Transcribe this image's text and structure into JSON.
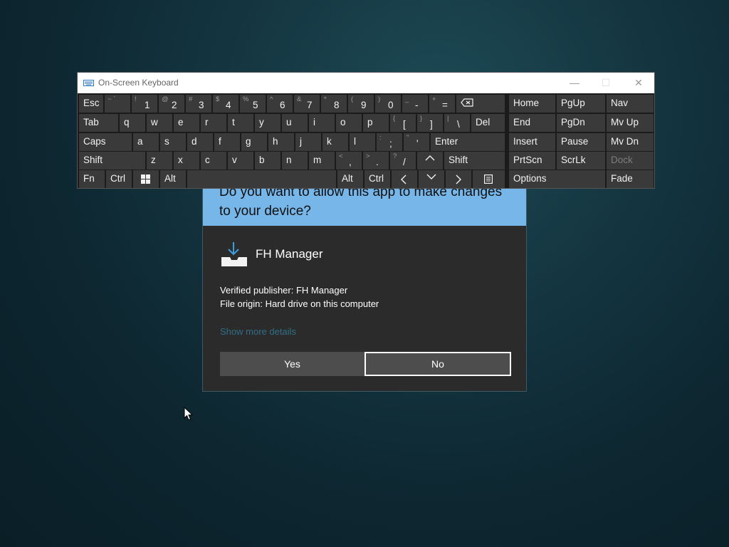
{
  "uac": {
    "question": "Do you want to allow this app to make changes to your device?",
    "app_name": "FH Manager",
    "publisher": "Verified publisher: FH Manager",
    "origin": "File origin: Hard drive on this computer",
    "more_details": "Show more details",
    "yes_label": "Yes",
    "no_label": "No"
  },
  "osk": {
    "title": "On-Screen Keyboard",
    "controls": {
      "minimize": "—",
      "maximize": "☐",
      "close": "✕"
    },
    "keys": {
      "esc": "Esc",
      "tilde": {
        "shift": "~ `",
        "main": ""
      },
      "d1": {
        "shift": "!",
        "main": "1"
      },
      "d2": {
        "shift": "@",
        "main": "2"
      },
      "d3": {
        "shift": "#",
        "main": "3"
      },
      "d4": {
        "shift": "$",
        "main": "4"
      },
      "d5": {
        "shift": "%",
        "main": "5"
      },
      "d6": {
        "shift": "^",
        "main": "6"
      },
      "d7": {
        "shift": "&",
        "main": "7"
      },
      "d8": {
        "shift": "*",
        "main": "8"
      },
      "d9": {
        "shift": "(",
        "main": "9"
      },
      "d0": {
        "shift": ")",
        "main": "0"
      },
      "minus": {
        "shift": "_",
        "main": "-"
      },
      "equals": {
        "shift": "+",
        "main": "="
      },
      "home": "Home",
      "pgup": "PgUp",
      "nav": "Nav",
      "tab": "Tab",
      "q": "q",
      "w": "w",
      "e": "e",
      "r": "r",
      "t": "t",
      "y": "y",
      "u": "u",
      "i": "i",
      "o": "o",
      "p": "p",
      "lbracket": {
        "shift": "{",
        "main": "["
      },
      "rbracket": {
        "shift": "}",
        "main": "]"
      },
      "backslash": {
        "shift": "|",
        "main": "\\"
      },
      "del": "Del",
      "end": "End",
      "pgdn": "PgDn",
      "mvup": "Mv Up",
      "caps": "Caps",
      "a": "a",
      "s": "s",
      "d": "d",
      "f": "f",
      "g": "g",
      "h": "h",
      "j": "j",
      "k": "k",
      "l": "l",
      "semicolon": {
        "shift": ":",
        "main": ";"
      },
      "quote": {
        "shift": "\"",
        "main": "'"
      },
      "enter": "Enter",
      "insert": "Insert",
      "pause": "Pause",
      "mvdn": "Mv Dn",
      "lshift": "Shift",
      "z": "z",
      "x": "x",
      "c": "c",
      "v": "v",
      "b": "b",
      "n": "n",
      "m": "m",
      "comma": {
        "shift": "<",
        "main": ","
      },
      "period": {
        "shift": ">",
        "main": "."
      },
      "slash": {
        "shift": "?",
        "main": "/"
      },
      "rshift": "Shift",
      "prtscn": "PrtScn",
      "scrlk": "ScrLk",
      "dock": "Dock",
      "fn": "Fn",
      "lctrl": "Ctrl",
      "lalt": "Alt",
      "ralt": "Alt",
      "rctrl": "Ctrl",
      "options": "Options",
      "fade": "Fade"
    }
  },
  "icons": {
    "keyboard": "keyboard-icon",
    "app": "download-tray-icon",
    "backspace": "backspace-icon",
    "windows": "windows-logo-icon",
    "up": "up-arrow-icon",
    "down": "down-arrow-icon",
    "left": "left-arrow-icon",
    "right": "right-arrow-icon",
    "menu": "context-menu-icon",
    "cursor": "mouse-pointer-icon"
  },
  "colors": {
    "uac_header": "#77b6e9",
    "uac_body": "#2b2b2b",
    "key_bg": "#3a3a3a",
    "osk_bg": "#1b1b1b",
    "link": "#2f6f86"
  }
}
